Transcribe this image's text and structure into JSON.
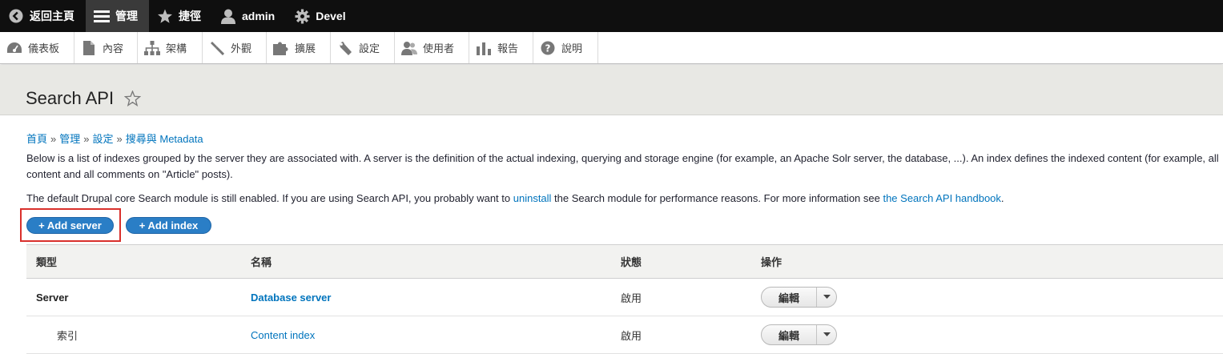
{
  "toolbar": {
    "items": [
      {
        "label": "返回主頁",
        "icon": "back-arrow-icon"
      },
      {
        "label": "管理",
        "icon": "hamburger-icon",
        "active": true
      },
      {
        "label": "捷徑",
        "icon": "star-icon"
      },
      {
        "label": "admin",
        "icon": "user-icon"
      },
      {
        "label": "Devel",
        "icon": "gear-icon"
      }
    ]
  },
  "tray": {
    "items": [
      {
        "label": "儀表板",
        "icon": "dashboard-icon"
      },
      {
        "label": "內容",
        "icon": "document-icon"
      },
      {
        "label": "架構",
        "icon": "structure-icon"
      },
      {
        "label": "外觀",
        "icon": "paintbrush-icon"
      },
      {
        "label": "擴展",
        "icon": "puzzle-icon"
      },
      {
        "label": "設定",
        "icon": "wrench-icon"
      },
      {
        "label": "使用者",
        "icon": "people-icon"
      },
      {
        "label": "報告",
        "icon": "bar-chart-icon"
      },
      {
        "label": "說明",
        "icon": "help-icon"
      }
    ]
  },
  "page": {
    "title": "Search API",
    "breadcrumb": [
      "首頁",
      "管理",
      "設定",
      "搜尋與 Metadata"
    ],
    "breadcrumb_separator": "»",
    "description": "Below is a list of indexes grouped by the server they are associated with. A server is the definition of the actual indexing, querying and storage engine (for example, an Apache Solr server, the database, ...). An index defines the indexed content (for example, all content and all comments on \"Article\" posts).",
    "notice": {
      "before": "The default Drupal core Search module is still enabled. If you are using Search API, you probably want to ",
      "link1": "uninstall",
      "middle": " the Search module for performance reasons. For more information see ",
      "link2": "the Search API handbook",
      "after": "."
    }
  },
  "actions": {
    "add_server": "+ Add server",
    "add_index": "+ Add index"
  },
  "table": {
    "headers": [
      "類型",
      "名稱",
      "狀態",
      "操作"
    ],
    "rows": [
      {
        "type": "Server",
        "name": "Database server",
        "status": "啟用",
        "op": "編輯"
      },
      {
        "type": "索引",
        "name": "Content index",
        "status": "啟用",
        "op": "編輯"
      }
    ]
  },
  "colors": {
    "link": "#0074bd",
    "primary_button": "#2a7ec6",
    "highlight": "#d9302c",
    "toolbar": "#0f0f0f"
  }
}
